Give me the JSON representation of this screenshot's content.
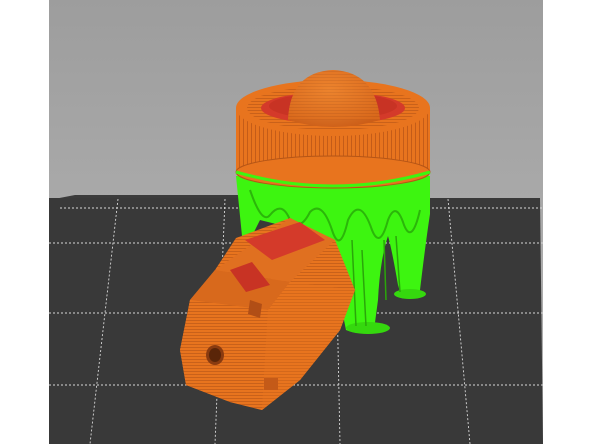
{
  "scene": {
    "background": "#a6a6a6",
    "bed_color": "#3a3a3a",
    "grid_color": "#dcdcdc",
    "model_parts": [
      {
        "name": "cylindrical-cap-with-dome",
        "color": "#e8741e"
      },
      {
        "name": "support-structures",
        "color": "#3df510"
      },
      {
        "name": "lying-box-part",
        "color": "#e8741e"
      }
    ],
    "highlight_color": "#d43a2a"
  }
}
